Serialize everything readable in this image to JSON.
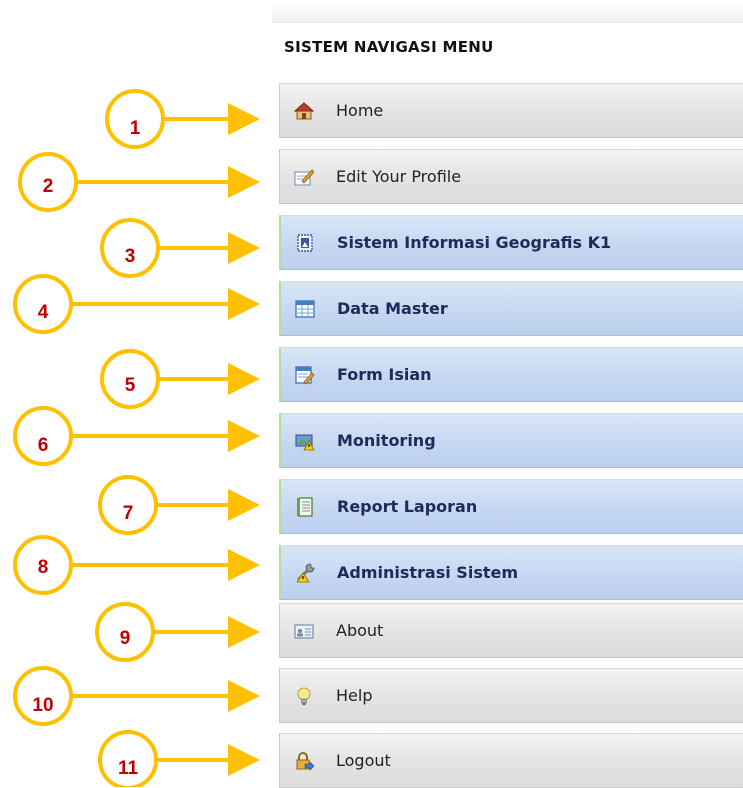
{
  "menu": {
    "title": "SISTEM NAVIGASI MENU",
    "items": [
      {
        "label": "Home",
        "icon": "home-icon",
        "style": "gray"
      },
      {
        "label": "Edit Your Profile",
        "icon": "edit-profile-icon",
        "style": "gray"
      },
      {
        "label": "Sistem Informasi Geografis K1",
        "icon": "map-icon",
        "style": "blue"
      },
      {
        "label": "Data Master",
        "icon": "table-icon",
        "style": "blue"
      },
      {
        "label": "Form Isian",
        "icon": "form-edit-icon",
        "style": "blue"
      },
      {
        "label": "Monitoring",
        "icon": "monitor-warning-icon",
        "style": "blue"
      },
      {
        "label": "Report Laporan",
        "icon": "report-book-icon",
        "style": "blue"
      },
      {
        "label": "Administrasi Sistem",
        "icon": "wrench-warning-icon",
        "style": "blue"
      },
      {
        "label": "About",
        "icon": "id-card-icon",
        "style": "gray"
      },
      {
        "label": "Help",
        "icon": "lightbulb-icon",
        "style": "gray"
      },
      {
        "label": "Logout",
        "icon": "lock-logout-icon",
        "style": "gray"
      }
    ]
  },
  "annotations": [
    "1",
    "2",
    "3",
    "4",
    "5",
    "6",
    "7",
    "8",
    "9",
    "10",
    "11"
  ],
  "colors": {
    "arrow": "#ffc000",
    "number": "#c00000",
    "gray_item": "#e2e2e2",
    "blue_item": "#c4d6f1",
    "blue_text": "#1f2a5a"
  }
}
